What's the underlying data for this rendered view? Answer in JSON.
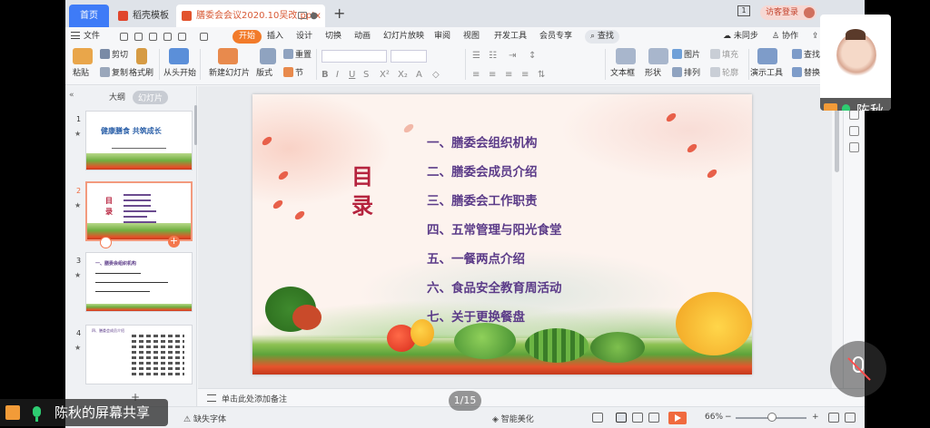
{
  "tabs": {
    "home": "首页",
    "template": "稻壳模板",
    "document": "膳委会会议2020.10吴改.pptx"
  },
  "titlebar": {
    "badge": "1",
    "guest_login": "访客登录"
  },
  "menu": {
    "file": "文件",
    "start": "开始",
    "insert": "插入",
    "design": "设计",
    "transition": "切换",
    "animation": "动画",
    "slideshow": "幻灯片放映",
    "review": "审阅",
    "view": "视图",
    "dev": "开发工具",
    "member": "会员专享",
    "search": "查找",
    "unsync": "未同步",
    "collab": "协作",
    "share": "分享"
  },
  "ribbon": {
    "paste": "粘贴",
    "cut": "剪切",
    "copy": "复制",
    "format_painter": "格式刷",
    "from_start": "从头开始",
    "new_slide": "新建幻灯片",
    "layout": "版式",
    "reset": "重置",
    "section": "节",
    "textbox": "文本框",
    "shape": "形状",
    "picture": "图片",
    "arrange": "排列",
    "fill": "填充",
    "outline": "轮廓",
    "present_tools": "演示工具",
    "find": "查找",
    "replace": "替换"
  },
  "left_panel": {
    "tab_outline": "大纲",
    "tab_slides": "幻灯片",
    "thumb1_title": "健康膳食  共筑成长",
    "thumb2_title": "目录",
    "thumb3_heading": "一、膳委会组织机构",
    "thumb4_heading": "四、膳委会成员介绍",
    "numbers": [
      "1",
      "2",
      "3",
      "4"
    ]
  },
  "slide": {
    "title": "目录",
    "items": [
      "一、膳委会组织机构",
      "二、膳委会成员介绍",
      "三、膳委会工作职责",
      "四、五常管理与阳光食堂",
      "五、一餐两点介绍",
      "六、食品安全教育周活动",
      "七、关于更换餐盘"
    ]
  },
  "notes_placeholder": "单击此处添加备注",
  "status": {
    "missing_fonts": "缺失字体",
    "smart_beautify": "智能美化",
    "zoom": "66%"
  },
  "overlay": {
    "pager": "1/15",
    "screen_share": "陈秋的屏幕共享",
    "participant": "陈秋"
  },
  "colors": {
    "accent_orange": "#f27b2a",
    "toc_purple": "#5b3b88",
    "title_red": "#b5233e",
    "home_tab_blue": "#3e7bf7"
  }
}
